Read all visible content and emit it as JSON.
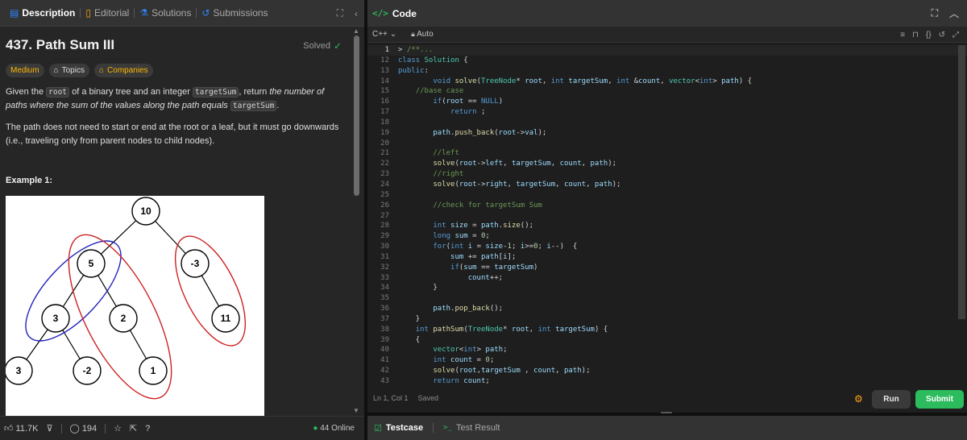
{
  "left_tabs": [
    {
      "label": "Description",
      "icon": "description-icon",
      "color": "#2e86ff"
    },
    {
      "label": "Editorial",
      "icon": "book-icon",
      "color": "#ffa116"
    },
    {
      "label": "Solutions",
      "icon": "flask-icon",
      "color": "#2e86ff"
    },
    {
      "label": "Submissions",
      "icon": "history-icon",
      "color": "#2e86ff"
    }
  ],
  "problem": {
    "title": "437. Path Sum III",
    "status": "Solved",
    "tags": {
      "difficulty": "Medium",
      "topics": "Topics",
      "companies": "Companies"
    },
    "para1": {
      "t1": "Given the ",
      "c1": "root",
      "t2": " of a binary tree and an integer ",
      "c2": "targetSum",
      "t3": ", return ",
      "i1": "the number of paths where the sum of the values along the path equals",
      "t4": " ",
      "c3": "targetSum",
      "t5": "."
    },
    "para2": "The path does not need to start or end at the root or a leaf, but it must go downwards (i.e., traveling only from parent nodes to child nodes).",
    "example_label": "Example 1:"
  },
  "tree": {
    "nodes": [
      "10",
      "5",
      "-3",
      "3",
      "2",
      "11",
      "3",
      "-2",
      "1"
    ],
    "ellipse_colors": {
      "blue": "#2222bb",
      "red": "#cc2222"
    }
  },
  "left_footer": {
    "likes": "11.7K",
    "comments": "194",
    "online": "44 Online"
  },
  "code_header": {
    "title": "Code"
  },
  "editor": {
    "language": "C++",
    "autocomplete": "Auto",
    "status": "Ln 1, Col 1",
    "saved": "Saved"
  },
  "buttons": {
    "run": "Run",
    "submit": "Submit"
  },
  "bottom_tabs": {
    "testcase": "Testcase",
    "result": "Test Result"
  },
  "code_lines": [
    {
      "n": "1",
      "html": "<span class='op'>&gt; </span><span class='cm'>/**...</span>"
    },
    {
      "n": "12",
      "html": "<span class='kw'>class</span> <span class='ty'>Solution</span> {"
    },
    {
      "n": "13",
      "html": "<span class='kw'>public</span>:"
    },
    {
      "n": "14",
      "html": "        <span class='kw'>void</span> <span class='fn'>solve</span>(<span class='ty'>TreeNode</span>* <span class='vr'>root</span>, <span class='kw'>int</span> <span class='vr'>targetSum</span>, <span class='kw'>int</span> &amp;<span class='vr'>count</span>, <span class='ty'>vector</span>&lt;<span class='kw'>int</span>&gt; <span class='vr'>path</span>) {"
    },
    {
      "n": "15",
      "html": "    <span class='cm'>//base case</span>"
    },
    {
      "n": "16",
      "html": "        <span class='kw'>if</span>(<span class='vr'>root</span> == <span class='kw'>NULL</span>)"
    },
    {
      "n": "17",
      "html": "            <span class='kw'>return</span> ;"
    },
    {
      "n": "18",
      "html": ""
    },
    {
      "n": "19",
      "html": "        <span class='vr'>path</span>.<span class='fn'>push_back</span>(<span class='vr'>root</span>-&gt;<span class='vr'>val</span>);"
    },
    {
      "n": "20",
      "html": ""
    },
    {
      "n": "21",
      "html": "        <span class='cm'>//left</span>"
    },
    {
      "n": "22",
      "html": "        <span class='fn'>solve</span>(<span class='vr'>root</span>-&gt;<span class='vr'>left</span>, <span class='vr'>targetSum</span>, <span class='vr'>count</span>, <span class='vr'>path</span>);"
    },
    {
      "n": "23",
      "html": "        <span class='cm'>//right</span>"
    },
    {
      "n": "24",
      "html": "        <span class='fn'>solve</span>(<span class='vr'>root</span>-&gt;<span class='vr'>right</span>, <span class='vr'>targetSum</span>, <span class='vr'>count</span>, <span class='vr'>path</span>);"
    },
    {
      "n": "25",
      "html": ""
    },
    {
      "n": "26",
      "html": "        <span class='cm'>//check for targetSum Sum</span>"
    },
    {
      "n": "27",
      "html": ""
    },
    {
      "n": "28",
      "html": "        <span class='kw'>int</span> <span class='vr'>size</span> = <span class='vr'>path</span>.<span class='fn'>size</span>();"
    },
    {
      "n": "29",
      "html": "        <span class='kw'>long</span> <span class='vr'>sum</span> = <span class='nu'>0</span>;"
    },
    {
      "n": "30",
      "html": "        <span class='kw'>for</span>(<span class='kw'>int</span> <span class='vr'>i</span> = <span class='vr'>size</span>-<span class='nu'>1</span>; <span class='vr'>i</span>&gt;=<span class='nu'>0</span>; <span class='vr'>i</span>--)  {"
    },
    {
      "n": "31",
      "html": "            <span class='vr'>sum</span> += <span class='vr'>path</span>[<span class='vr'>i</span>];"
    },
    {
      "n": "32",
      "html": "            <span class='kw'>if</span>(<span class='vr'>sum</span> == <span class='vr'>targetSum</span>)"
    },
    {
      "n": "33",
      "html": "                <span class='vr'>count</span>++;"
    },
    {
      "n": "34",
      "html": "        }"
    },
    {
      "n": "35",
      "html": ""
    },
    {
      "n": "36",
      "html": "        <span class='vr'>path</span>.<span class='fn'>pop_back</span>();"
    },
    {
      "n": "37",
      "html": "    }"
    },
    {
      "n": "38",
      "html": "    <span class='kw'>int</span> <span class='fn'>pathSum</span>(<span class='ty'>TreeNode</span>* <span class='vr'>root</span>, <span class='kw'>int</span> <span class='vr'>targetSum</span>) {"
    },
    {
      "n": "39",
      "html": "    {"
    },
    {
      "n": "40",
      "html": "        <span class='ty'>vector</span>&lt;<span class='kw'>int</span>&gt; <span class='vr'>path</span>;"
    },
    {
      "n": "41",
      "html": "        <span class='kw'>int</span> <span class='vr'>count</span> = <span class='nu'>0</span>;"
    },
    {
      "n": "42",
      "html": "        <span class='fn'>solve</span>(<span class='vr'>root</span>,<span class='vr'>targetSum</span> , <span class='vr'>count</span>, <span class='vr'>path</span>);"
    },
    {
      "n": "43",
      "html": "        <span class='kw'>return</span> <span class='vr'>count</span>;"
    }
  ]
}
